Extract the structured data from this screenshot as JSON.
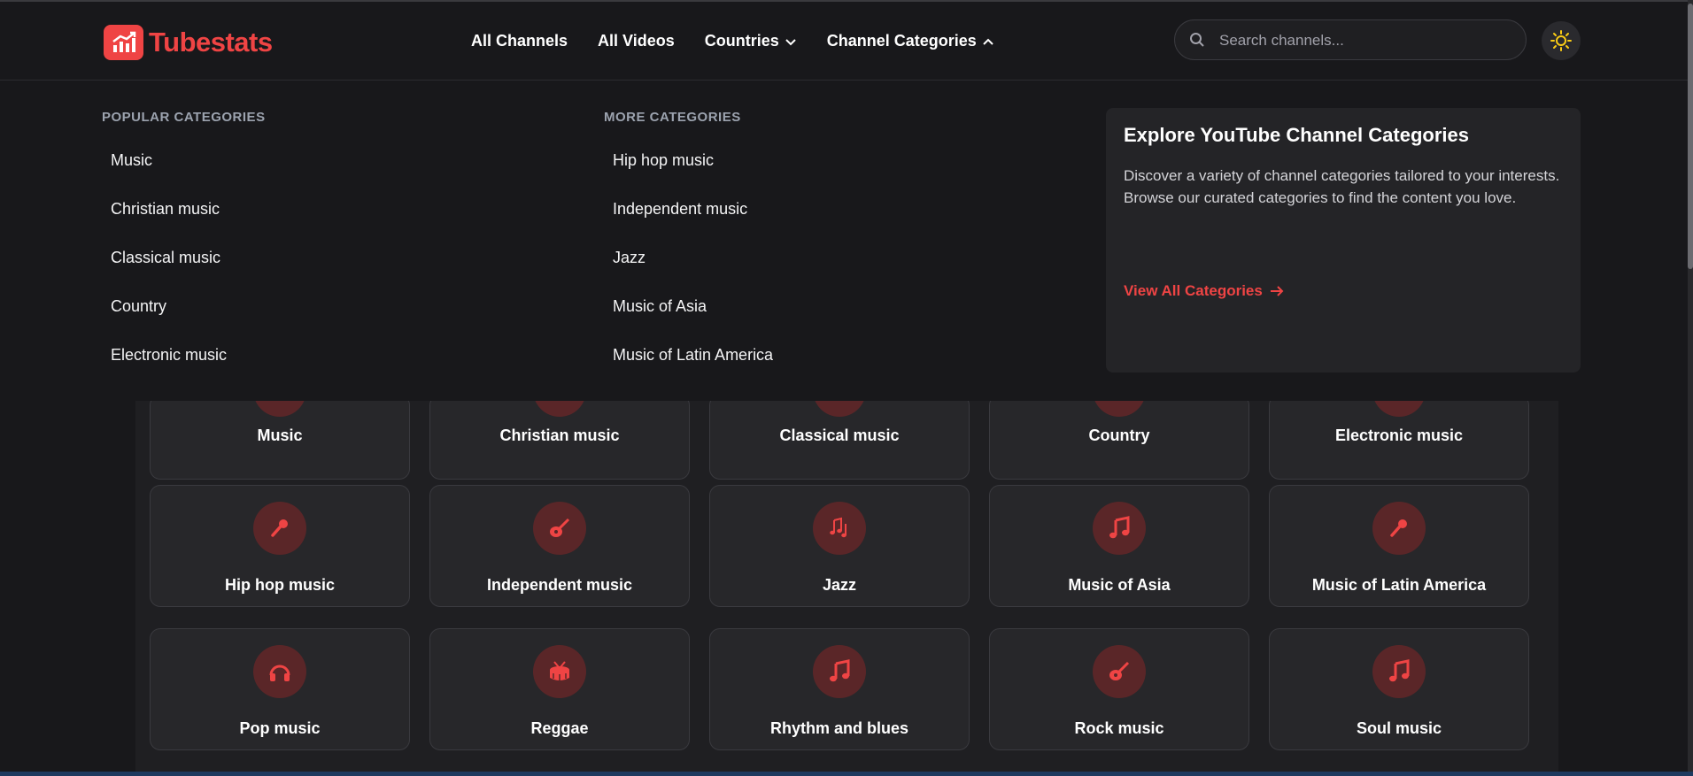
{
  "app": {
    "name": "Tubestats"
  },
  "nav": {
    "all_channels": "All Channels",
    "all_videos": "All Videos",
    "countries": "Countries",
    "channel_categories": "Channel Categories"
  },
  "search": {
    "placeholder": "Search channels..."
  },
  "mega_menu": {
    "popular_title": "POPULAR CATEGORIES",
    "popular": [
      "Music",
      "Christian music",
      "Classical music",
      "Country",
      "Electronic music"
    ],
    "more_title": "MORE CATEGORIES",
    "more": [
      "Hip hop music",
      "Independent music",
      "Jazz",
      "Music of Asia",
      "Music of Latin America"
    ],
    "explore": {
      "title": "Explore YouTube Channel Categories",
      "description": "Discover a variety of channel categories tailored to your interests. Browse our curated categories to find the content you love.",
      "cta": "View All Categories"
    }
  },
  "categories": [
    {
      "label": "Music",
      "icon": "music-icon"
    },
    {
      "label": "Christian music",
      "icon": "music-icon"
    },
    {
      "label": "Classical music",
      "icon": "music-icon"
    },
    {
      "label": "Country",
      "icon": "music-icon"
    },
    {
      "label": "Electronic music",
      "icon": "music-icon"
    },
    {
      "label": "Hip hop music",
      "icon": "microphone-icon"
    },
    {
      "label": "Independent music",
      "icon": "guitar-icon"
    },
    {
      "label": "Jazz",
      "icon": "music-notes-icon"
    },
    {
      "label": "Music of Asia",
      "icon": "music-icon"
    },
    {
      "label": "Music of Latin America",
      "icon": "microphone-icon"
    },
    {
      "label": "Pop music",
      "icon": "headphones-icon"
    },
    {
      "label": "Reggae",
      "icon": "drum-icon"
    },
    {
      "label": "Rhythm and blues",
      "icon": "music-icon"
    },
    {
      "label": "Rock music",
      "icon": "guitar-icon"
    },
    {
      "label": "Soul music",
      "icon": "music-icon"
    }
  ],
  "colors": {
    "accent": "#ef4444",
    "background": "#18181b",
    "card": "#27272a"
  }
}
